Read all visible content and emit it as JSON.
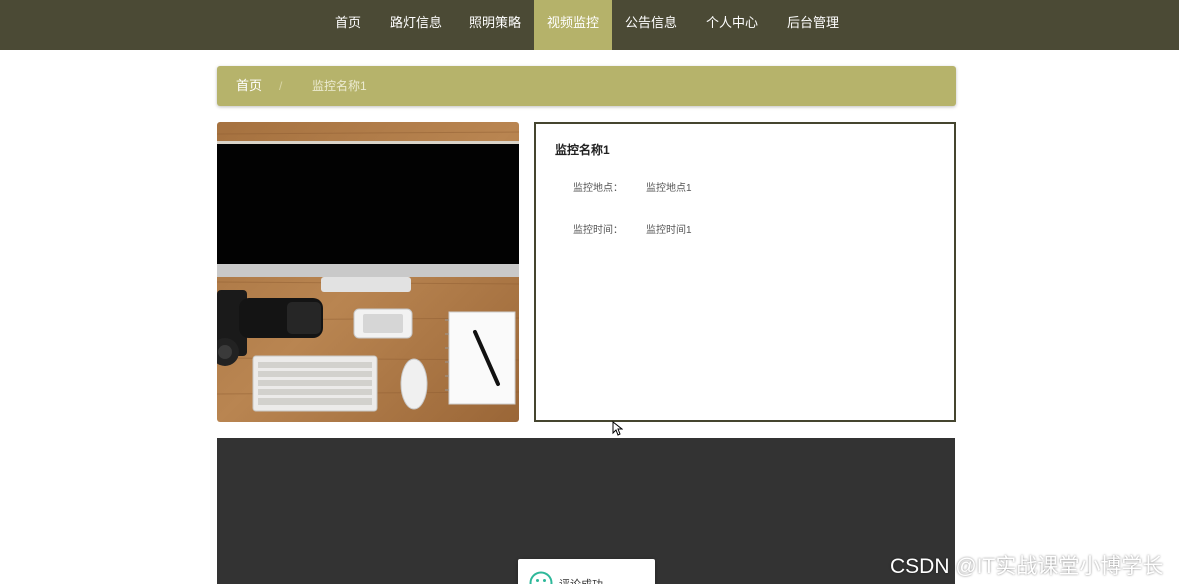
{
  "nav": {
    "items": [
      {
        "label": "首页"
      },
      {
        "label": "路灯信息"
      },
      {
        "label": "照明策略"
      },
      {
        "label": "视频监控"
      },
      {
        "label": "公告信息"
      },
      {
        "label": "个人中心"
      },
      {
        "label": "后台管理"
      }
    ],
    "active": "视频监控"
  },
  "breadcrumb": {
    "home": "首页",
    "separator": "/",
    "current": "监控名称1"
  },
  "photo": {
    "subject": "desk with monitor, camera, phone, keyboard, mouse, notebook and pen"
  },
  "detail": {
    "title": "监控名称1",
    "fields": [
      {
        "label": "监控地点：",
        "value": "监控地点1"
      },
      {
        "label": "监控时间：",
        "value": "监控时间1"
      }
    ]
  },
  "toast": {
    "icon": "smile-icon",
    "message": "评论成功"
  },
  "watermark": "CSDN @IT实战课堂小博学长",
  "colors": {
    "navbar": "#4b4a35",
    "accent": "#b5b26a",
    "detail_border": "#45452f",
    "footer": "#333333",
    "toast_icon": "#2eb89a"
  }
}
